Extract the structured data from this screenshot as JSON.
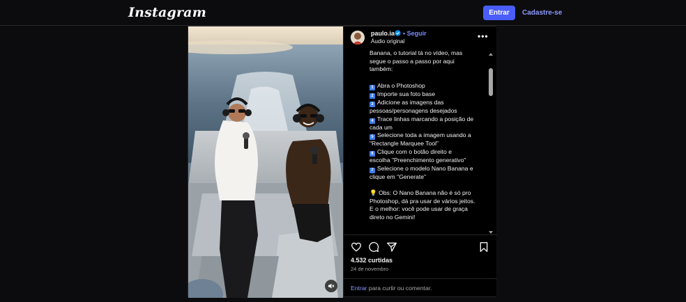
{
  "header": {
    "logo": "Instagram",
    "login_label": "Entrar",
    "signup_label": "Cadastre-se"
  },
  "post": {
    "username": "paulo.ia",
    "follow_label": "Seguir",
    "follow_separator": "•",
    "audio": "Áudio original",
    "more_label": "•••",
    "caption_lines": [
      "Banana, o tutorial tá no vídeo, mas",
      "segue o passo a passo por aqui",
      "também:"
    ],
    "steps": [
      {
        "n": "1",
        "lines": [
          "Abra o Photoshop"
        ]
      },
      {
        "n": "2",
        "lines": [
          "Importe sua foto base"
        ]
      },
      {
        "n": "3",
        "lines": [
          "Adicione as imagens das",
          "pessoas/personagens desejados"
        ]
      },
      {
        "n": "4",
        "lines": [
          "Trace linhas marcando a posição de",
          "cada um"
        ]
      },
      {
        "n": "5",
        "lines": [
          "Selecione toda a imagem usando a",
          "\"Rectangle Marquee Tool\""
        ]
      },
      {
        "n": "6",
        "lines": [
          "Clique com o botão direito e",
          "escolha \"Preenchimento generativo\""
        ]
      },
      {
        "n": "7",
        "lines": [
          "Selecione o modelo Nano Banana e",
          "clique em \"Generate\""
        ]
      }
    ],
    "obs_lines": [
      "💡 Obs: O Nano Banana não é só pro",
      "Photoshop, dá pra usar de vários jeitos.",
      "E o melhor: você pode usar de graça",
      "direto no Gemini!"
    ],
    "likes": "4.532 curtidas",
    "date": "24 de novembro",
    "login_link": "Entrar",
    "login_prompt": " para curtir ou comentar."
  },
  "icons": {
    "like": "heart-icon",
    "comment": "comment-icon",
    "share": "send-icon",
    "save": "bookmark-icon",
    "mute": "muted-speaker-icon",
    "verified": "verified-badge-icon",
    "more": "more-options-icon"
  },
  "colors": {
    "background": "#0c0c0e",
    "primary_button": "#4a5df9",
    "link": "#8d9bff",
    "verified": "#0095f6"
  }
}
